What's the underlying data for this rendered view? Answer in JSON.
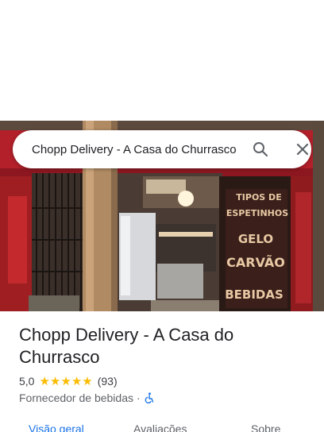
{
  "search": {
    "query": "Chopp Delivery - A Casa do Churrasco",
    "search_icon": "search-icon",
    "close_icon": "close-icon"
  },
  "photo": {
    "sign_lines": [
      "TIPOS DE",
      "ESPETINHOS",
      "GELO",
      "CARVÃO",
      "BEBIDAS"
    ]
  },
  "place": {
    "title": "Chopp Delivery - A Casa do Churrasco",
    "rating": "5,0",
    "stars": [
      "★",
      "★",
      "★",
      "★",
      "★"
    ],
    "review_count": "(93)",
    "category": "Fornecedor de bebidas",
    "separator": "·",
    "accessibility_icon": "wheelchair-icon"
  },
  "tabs": {
    "overview": "Visão geral",
    "reviews": "Avaliações",
    "about": "Sobre"
  },
  "colors": {
    "accent": "#1a73e8",
    "star": "#fbbc04",
    "sign_text": "#e8c9a4"
  }
}
